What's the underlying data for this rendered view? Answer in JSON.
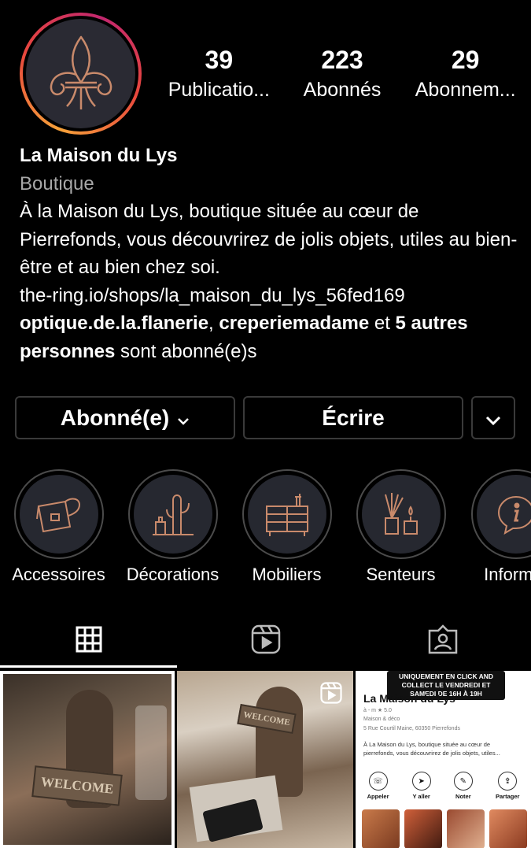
{
  "profile": {
    "name": "La Maison du Lys",
    "category": "Boutique",
    "bio": "À la Maison du Lys, boutique située au cœur de Pierrefonds, vous découvrirez de jolis objets, utiles au bien-être et au bien chez soi.",
    "link": "the-ring.io/shops/la_maison_du_lys_56fed169",
    "followed_by_1": "optique.de.la.flanerie",
    "followed_by_sep": ", ",
    "followed_by_2": "creperiemadame",
    "followed_by_and": " et ",
    "followed_by_others": "5 autres personnes",
    "followed_by_suffix": " sont abonné(e)s"
  },
  "stats": [
    {
      "value": "39",
      "label": "Publicatio..."
    },
    {
      "value": "223",
      "label": "Abonnés"
    },
    {
      "value": "29",
      "label": "Abonnem..."
    }
  ],
  "buttons": {
    "follow": "Abonné(e)",
    "message": "Écrire"
  },
  "highlights": [
    {
      "label": "Accessoires",
      "icon": "bag-icon"
    },
    {
      "label": "Décorations",
      "icon": "cactus-icon"
    },
    {
      "label": "Mobiliers",
      "icon": "dresser-icon"
    },
    {
      "label": "Senteurs",
      "icon": "diffuser-icon"
    },
    {
      "label": "Informat",
      "icon": "info-icon"
    }
  ],
  "tabs": [
    "grid-icon",
    "reels-icon",
    "tagged-icon"
  ],
  "posts": {
    "p1_sign": "WELCOME",
    "p2_sign": "WELCOME",
    "p3_banner": "UNIQUEMENT EN CLICK AND COLLECT LE VENDREDI ET SAMEDI DE 16H À 19H",
    "p3_title": "La Maison du Lys",
    "p3_rating": "à - m ★ 5.0",
    "p3_type": "Maison & déco",
    "p3_address": "5 Rue Courtil Maine, 60350 Pierrefonds",
    "p3_text": "À La Maison du Lys, boutique située au cœur de pierrefonds, vous découvrirez de jolis objets, utiles...",
    "p3_actions": [
      "Appeler",
      "Y aller",
      "Noter",
      "Partager"
    ]
  },
  "colors": {
    "background": "#000000",
    "copper": "#c98a6b",
    "muted": "#a8a8a8",
    "border": "#3a3a3a"
  }
}
